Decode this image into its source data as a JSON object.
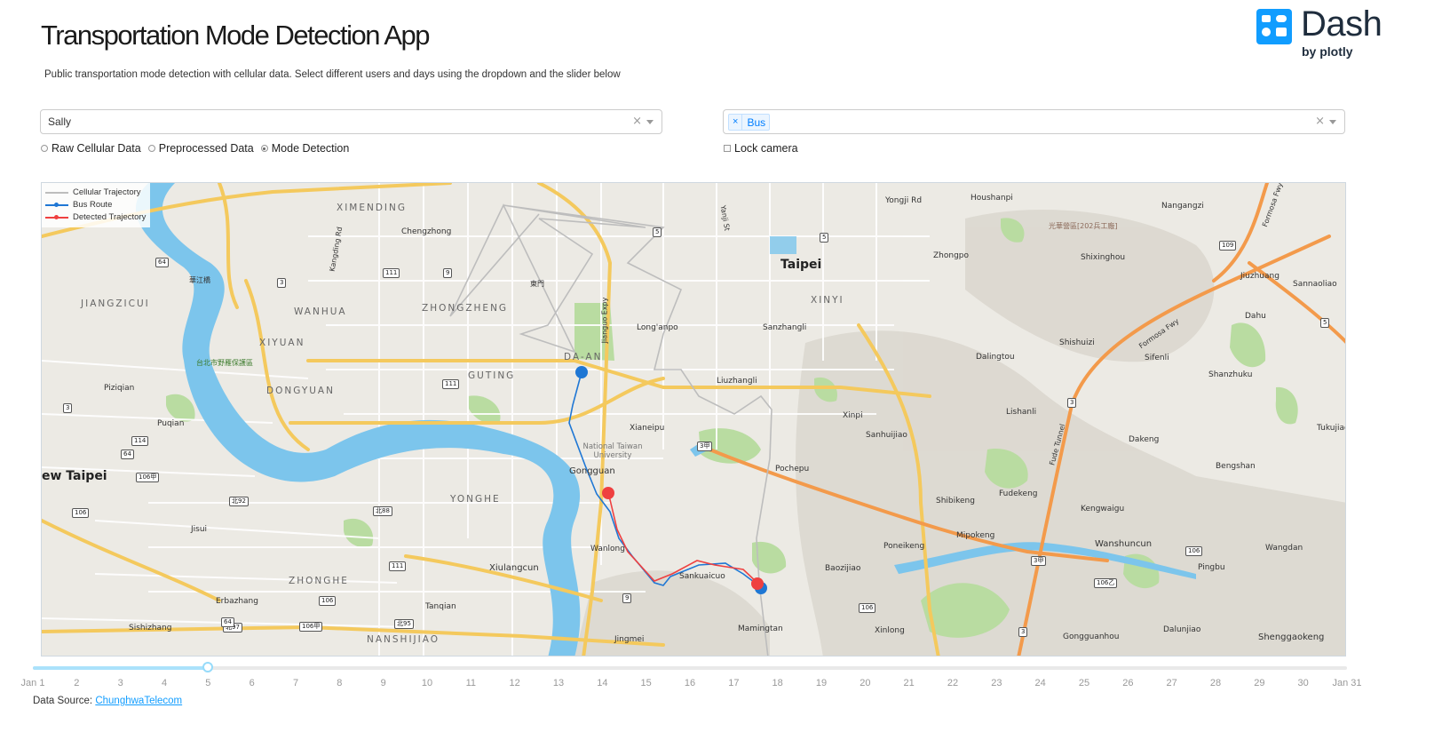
{
  "header": {
    "title": "Transportation Mode Detection App",
    "subtitle": "Public transportation mode detection with cellular data. Select different users and days using the dropdown and the slider below",
    "logo_word": "Dash",
    "logo_by": "by plotly",
    "logo_color": "#119dff"
  },
  "user_select": {
    "value": "Sally",
    "clear": "×"
  },
  "mode_select": {
    "tag_label": "Bus",
    "tag_remove": "×",
    "clear": "×"
  },
  "view_options": {
    "selected": "Mode Detection",
    "items": [
      "Raw Cellular Data",
      "Preprocessed Data",
      "Mode Detection"
    ]
  },
  "lock_camera": {
    "label": "Lock camera",
    "checked": false
  },
  "map": {
    "legend": [
      {
        "name": "Cellular Trajectory",
        "color": "#bdbdbd"
      },
      {
        "name": "Bus Route",
        "color": "#1f77d4"
      },
      {
        "name": "Detected Trajectory",
        "color": "#ef4040"
      }
    ],
    "labels": {
      "taipei": "Taipei",
      "new_taipei": "ew Taipei",
      "ximending": "XIMENDING",
      "jiangzicui": "JIANGZICUI",
      "wanhua": "WANHUA",
      "zhongzheng": "ZHONGZHENG",
      "xiyuan": "XIYUAN",
      "daan": "DA-AN",
      "guting": "GUTING",
      "dongyuan": "DONGYUAN",
      "xinyi": "XINYI",
      "yonghe": "YONGHE",
      "zhonghe": "ZHONGHE",
      "nanshijiao": "NANSHIJIAO",
      "chengzhong": "Chengzhong",
      "yongji": "Yongji Rd",
      "houshanpi": "Houshanpi",
      "nangangzi": "Nangangzi",
      "zhongpo": "Zhongpo",
      "shixinghou": "Shixinghou",
      "jiuzhuang": "Jiuzhuang",
      "sannaoliao": "Sannaoliao",
      "dahu": "Dahu",
      "sanzhangli": "Sanzhangli",
      "longanpo": "Long'anpo",
      "liuzhangli": "Liuzhangli",
      "dalingtou": "Dalingtou",
      "shishuizi": "Shishuizi",
      "sifenli": "Sifenli",
      "shanzhuku": "Shanzhuku",
      "xinpi": "Xinpi",
      "lishanli": "Lishanli",
      "sanhuijiao": "Sanhuijiao",
      "dakeng": "Dakeng",
      "tukujiao": "Tukujiao",
      "bengshan": "Bengshan",
      "xianeipu": "Xianeipu",
      "ntu": "National Taiwan University",
      "gongguan": "Gongguan",
      "pochepu": "Pochepu",
      "fudekeng": "Fudekeng",
      "kengwaigu": "Kengwaigu",
      "shibikeng": "Shibikeng",
      "mipokeng": "Mipokeng",
      "poneikeng": "Poneikeng",
      "wanshuncun": "Wanshuncun",
      "wangdan": "Wangdan",
      "pingbu": "Pingbu",
      "baozijiao": "Baozijiao",
      "wanlong": "Wanlong",
      "sankuaicuo": "Sankuaicuo",
      "xiulangcun": "Xiulangcun",
      "tanqian": "Tanqian",
      "mamingtan": "Mamingtan",
      "jingmei": "Jingmei",
      "xinlong": "Xinlong",
      "gongguanhou": "Gongguanhou",
      "dalunjiao": "Dalunjiao",
      "shenggaokeng": "Shenggaokeng",
      "piziqian": "Piziqian",
      "puqian": "Puqian",
      "jisui": "Jisui",
      "erbazhang": "Erbazhang",
      "sishizhang": "Sishizhang",
      "taipei_wildlife": "台北市野雁保護區",
      "huajiang": "華江橋",
      "dongmen": "東門",
      "guanghua": "光華營區[202兵工廠]",
      "jianguo": "Jianguo Expy",
      "yanji": "Yanji St",
      "kangding": "Kangding Rd",
      "formosa1": "Formosa Fwy",
      "formosa2": "Formosa Fwy",
      "fude": "Fude Tunnel"
    },
    "shields": [
      "64",
      "3",
      "111",
      "9",
      "5",
      "5",
      "109",
      "5",
      "111",
      "3",
      "114",
      "64",
      "106甲",
      "北92",
      "106",
      "北88",
      "3甲",
      "111",
      "106",
      "北95",
      "106甲",
      "北97",
      "64",
      "9",
      "106",
      "3甲",
      "106",
      "106乙",
      "3",
      "3"
    ]
  },
  "slider": {
    "current": 5,
    "marks": [
      "Jan 1",
      "2",
      "3",
      "4",
      "5",
      "6",
      "7",
      "8",
      "9",
      "10",
      "11",
      "12",
      "13",
      "14",
      "15",
      "16",
      "17",
      "18",
      "19",
      "20",
      "21",
      "22",
      "23",
      "24",
      "25",
      "26",
      "27",
      "28",
      "29",
      "30",
      "Jan 31"
    ]
  },
  "footer": {
    "label": "Data Source:",
    "link": "ChunghwaTelecom"
  }
}
